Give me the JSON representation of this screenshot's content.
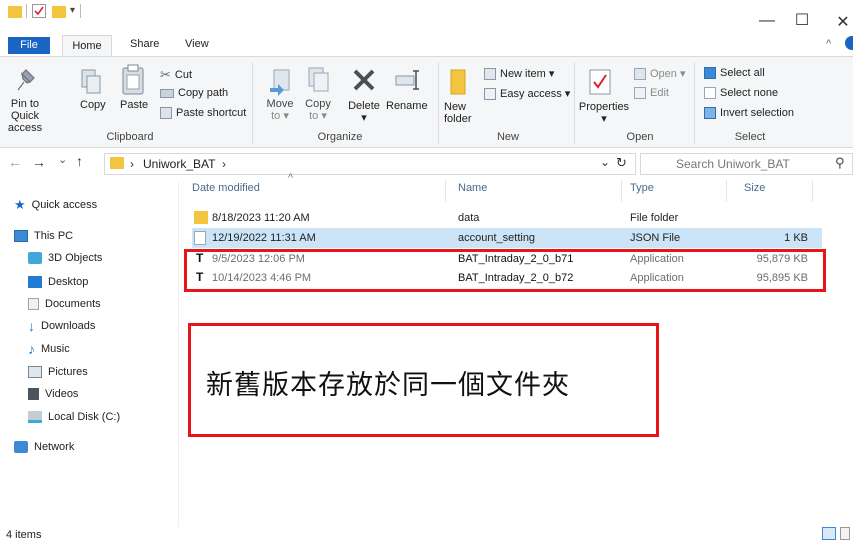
{
  "window": {
    "minimize": "—",
    "maximize": "☐",
    "close": "✕",
    "collapse": "^"
  },
  "tabs": [
    {
      "label": "File"
    },
    {
      "label": "Home"
    },
    {
      "label": "Share"
    },
    {
      "label": "View"
    }
  ],
  "ribbon": {
    "clipboard": {
      "pin": "Pin to Quick access",
      "pin_l1": "Pin to Quick",
      "pin_l2": "access",
      "copy": "Copy",
      "paste": "Paste",
      "cut": "Cut",
      "copy_path": "Copy path",
      "paste_shortcut": "Paste shortcut",
      "group": "Clipboard"
    },
    "organize": {
      "move_l1": "Move",
      "move_l2": "to ▾",
      "copy_l1": "Copy",
      "copy_l2": "to ▾",
      "delete": "Delete",
      "delete_arrow": "▾",
      "rename": "Rename",
      "group": "Organize"
    },
    "new": {
      "new_folder_l1": "New",
      "new_folder_l2": "folder",
      "new_item": "New item ▾",
      "easy_access": "Easy access ▾",
      "group": "New"
    },
    "open": {
      "properties": "Properties",
      "properties_arrow": "▾",
      "open": "Open ▾",
      "edit": "Edit",
      "group": "Open"
    },
    "select": {
      "select_all": "Select all",
      "select_none": "Select none",
      "invert": "Invert selection",
      "group": "Select"
    }
  },
  "address": {
    "back": "←",
    "forward": "→",
    "recent": "⌄",
    "up": "↑",
    "sep": "›",
    "folder": "Uniwork_BAT",
    "sep2": "›",
    "dropdown": "⌄",
    "refresh": "↻",
    "search_placeholder": "Search Uniwork_BAT",
    "search_glyph": "⚲"
  },
  "nav": [
    {
      "label": "Quick access"
    },
    {
      "label": "This PC"
    },
    {
      "label": "3D Objects"
    },
    {
      "label": "Desktop"
    },
    {
      "label": "Documents"
    },
    {
      "label": "Downloads"
    },
    {
      "label": "Music"
    },
    {
      "label": "Pictures"
    },
    {
      "label": "Videos"
    },
    {
      "label": "Local Disk (C:)"
    },
    {
      "label": "Network"
    }
  ],
  "columns": {
    "date": "Date modified",
    "sort": "^",
    "name": "Name",
    "type": "Type",
    "size": "Size"
  },
  "files": [
    {
      "date": "8/18/2023 11:20 AM",
      "name": "data",
      "type": "File folder",
      "size": ""
    },
    {
      "date": "12/19/2022 11:31 AM",
      "name": "account_setting",
      "type": "JSON File",
      "size": "1 KB"
    },
    {
      "date": "9/5/2023 12:06 PM",
      "name": "BAT_Intraday_2_0_b71",
      "type": "Application",
      "size": "95,879 KB"
    },
    {
      "date": "10/14/2023 4:46 PM",
      "name": "BAT_Intraday_2_0_b72",
      "type": "Application",
      "size": "95,895 KB"
    }
  ],
  "app_icon_glyph": "T",
  "annotation": {
    "text": "新舊版本存放於同一個文件夾",
    "color": "#e8141c"
  },
  "status": {
    "count": "4 items"
  },
  "colors": {
    "accent": "#1a64c4",
    "selection": "#cce4f7",
    "folder": "#f3c53f"
  }
}
